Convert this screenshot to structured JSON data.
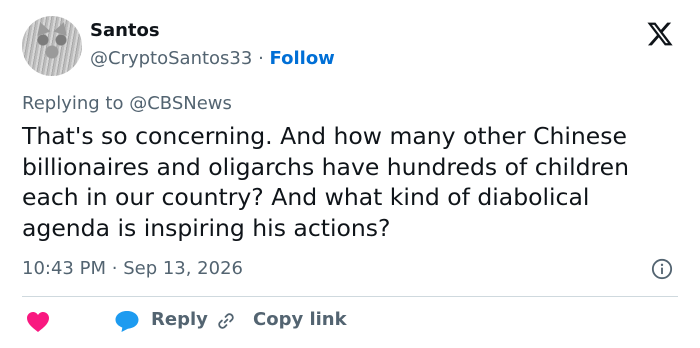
{
  "author": {
    "name": "Santos",
    "handle": "@CryptoSantos33",
    "separator": "·",
    "follow_label": "Follow",
    "avatar_icon": "cat-avatar"
  },
  "brand": {
    "icon": "x-logo-icon"
  },
  "reply_context": {
    "prefix": "Replying to",
    "target": "@CBSNews"
  },
  "tweet": {
    "text": "That's so concerning. And how many other Chinese billionaires and oligarchs have hundreds of children each in our country? And what kind of diabolical agenda is inspiring his actions?",
    "time": "10:43 PM",
    "separator": "·",
    "date": "Sep 13, 2026"
  },
  "actions": {
    "like_icon": "heart-icon",
    "reply_label": "Reply",
    "copy_label": "Copy link"
  },
  "colors": {
    "text": "#0f1419",
    "secondary": "#536471",
    "link": "#006fd6",
    "like": "#f91880",
    "reply": "#1d9bf0",
    "divider": "#cfd9de"
  }
}
